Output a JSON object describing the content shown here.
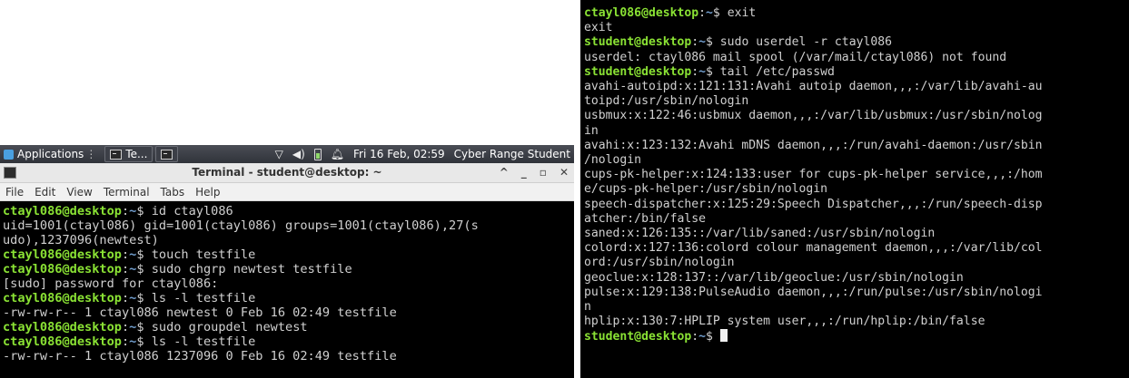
{
  "taskbar": {
    "apps_label": "Applications",
    "task1_label": "Te...",
    "datetime": "Fri 16 Feb, 02:59",
    "user_label": "Cyber Range Student"
  },
  "left_window": {
    "title": "Terminal - student@desktop: ~",
    "controls": {
      "minimize": "^",
      "restore": "_",
      "maximize": "▫",
      "close": "✕"
    },
    "menu": [
      "File",
      "Edit",
      "View",
      "Terminal",
      "Tabs",
      "Help"
    ],
    "lines": [
      {
        "user": "ctayl086@desktop",
        "path": "~",
        "cmd": "id ctayl086"
      },
      {
        "out": "uid=1001(ctayl086) gid=1001(ctayl086) groups=1001(ctayl086),27(s"
      },
      {
        "out": "udo),1237096(newtest)"
      },
      {
        "user": "ctayl086@desktop",
        "path": "~",
        "cmd": "touch testfile"
      },
      {
        "user": "ctayl086@desktop",
        "path": "~",
        "cmd": "sudo chgrp newtest testfile"
      },
      {
        "out": "[sudo] password for ctayl086:"
      },
      {
        "user": "ctayl086@desktop",
        "path": "~",
        "cmd": "ls -l testfile"
      },
      {
        "out": "-rw-rw-r-- 1 ctayl086 newtest 0 Feb 16 02:49 testfile"
      },
      {
        "user": "ctayl086@desktop",
        "path": "~",
        "cmd": "sudo groupdel newtest"
      },
      {
        "user": "ctayl086@desktop",
        "path": "~",
        "cmd": "ls -l testfile"
      },
      {
        "out": "-rw-rw-r-- 1 ctayl086 1237096 0 Feb 16 02:49 testfile"
      }
    ]
  },
  "right_window": {
    "lines": [
      {
        "user": "ctayl086@desktop",
        "path": "~",
        "cmd": "exit"
      },
      {
        "out": "exit"
      },
      {
        "user": "student@desktop",
        "path": "~",
        "cmd": "sudo userdel -r ctayl086"
      },
      {
        "out": "userdel: ctayl086 mail spool (/var/mail/ctayl086) not found"
      },
      {
        "user": "student@desktop",
        "path": "~",
        "cmd": "tail /etc/passwd"
      },
      {
        "out": "avahi-autoipd:x:121:131:Avahi autoip daemon,,,:/var/lib/avahi-au"
      },
      {
        "out": "toipd:/usr/sbin/nologin"
      },
      {
        "out": "usbmux:x:122:46:usbmux daemon,,,:/var/lib/usbmux:/usr/sbin/nolog"
      },
      {
        "out": "in"
      },
      {
        "out": "avahi:x:123:132:Avahi mDNS daemon,,,:/run/avahi-daemon:/usr/sbin"
      },
      {
        "out": "/nologin"
      },
      {
        "out": "cups-pk-helper:x:124:133:user for cups-pk-helper service,,,:/hom"
      },
      {
        "out": "e/cups-pk-helper:/usr/sbin/nologin"
      },
      {
        "out": "speech-dispatcher:x:125:29:Speech Dispatcher,,,:/run/speech-disp"
      },
      {
        "out": "atcher:/bin/false"
      },
      {
        "out": "saned:x:126:135::/var/lib/saned:/usr/sbin/nologin"
      },
      {
        "out": "colord:x:127:136:colord colour management daemon,,,:/var/lib/col"
      },
      {
        "out": "ord:/usr/sbin/nologin"
      },
      {
        "out": "geoclue:x:128:137::/var/lib/geoclue:/usr/sbin/nologin"
      },
      {
        "out": "pulse:x:129:138:PulseAudio daemon,,,:/run/pulse:/usr/sbin/nologi"
      },
      {
        "out": "n"
      },
      {
        "out": "hplip:x:130:7:HPLIP system user,,,:/run/hplip:/bin/false"
      },
      {
        "user": "student@desktop",
        "path": "~",
        "cmd": "",
        "cursor": true
      }
    ]
  },
  "colors": {
    "user": "#8ae234",
    "path": "#729fcf",
    "text": "#d0d0d0",
    "background": "#000000"
  }
}
